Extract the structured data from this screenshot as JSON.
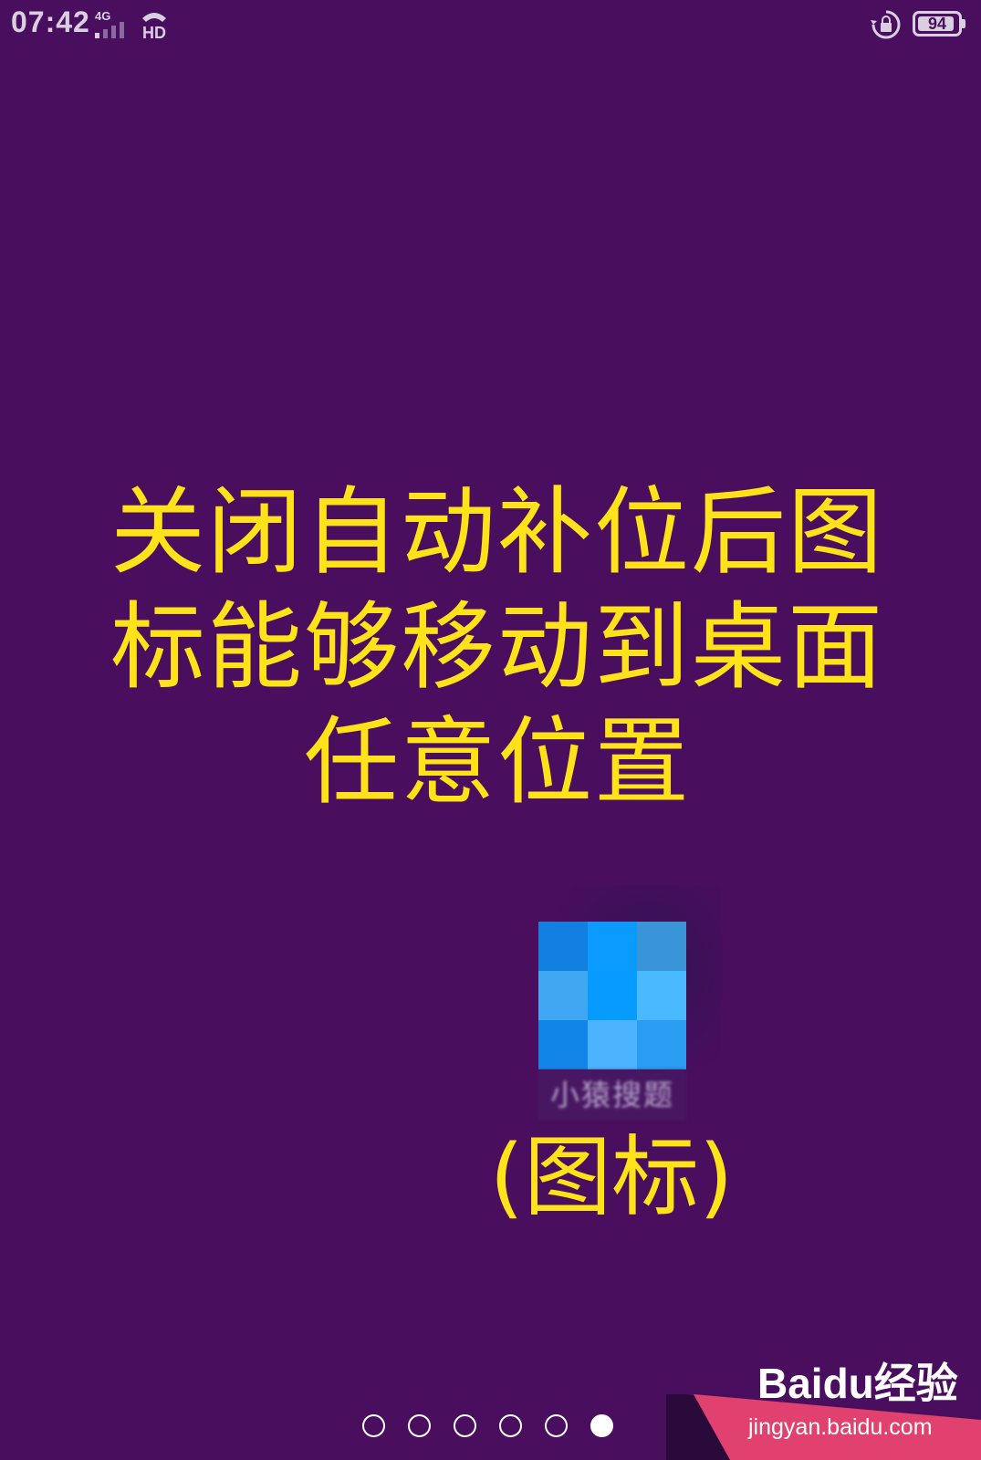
{
  "status_bar": {
    "time": "07:42",
    "network": "4G",
    "hd_label": "HD",
    "battery_level": "94",
    "battery_percent": 94
  },
  "headline": {
    "lines": [
      "关闭自动补位后图",
      "标能够移动到桌面",
      "任意位置"
    ]
  },
  "app_icon": {
    "label": "小猿搜题",
    "pixels": [
      "#1280e0",
      "#0b9bff",
      "#3a94d8",
      "#40a8f2",
      "#079bff",
      "#4ab8ff",
      "#1286e8",
      "#4ab4ff",
      "#2a9cf2"
    ]
  },
  "caption": "(图标)",
  "pager": {
    "count": 6,
    "active_index": 5
  },
  "watermark": {
    "logo": "Baidu经验",
    "url": "jingyan.baidu.com"
  },
  "colors": {
    "background": "#4a0e5e",
    "headline": "#ffe21a",
    "corner_band": "#e0416f"
  }
}
